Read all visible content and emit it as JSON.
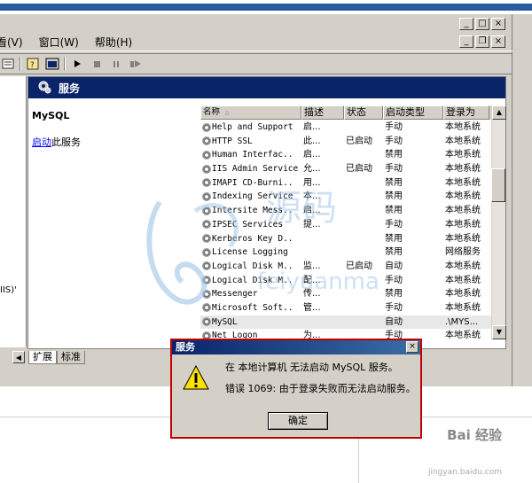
{
  "menu": {
    "view": "查看(V)",
    "window": "窗口(W)",
    "help": "帮助(H)"
  },
  "window_buttons": {
    "minimize": "_",
    "restore": "□",
    "close": "×"
  },
  "inner_window_buttons": {
    "minimize": "_",
    "restore": "❐",
    "close": "×"
  },
  "header": {
    "title": "服务"
  },
  "left_panel": {
    "truncated_text": "IIS)'"
  },
  "detail": {
    "service_name": "MySQL",
    "start_link": "启动",
    "start_suffix": "此服务"
  },
  "table": {
    "columns": [
      "名称",
      "描述",
      "状态",
      "启动类型",
      "登录为"
    ],
    "rows": [
      {
        "name": "Help and Support",
        "desc": "启...",
        "status": "",
        "startup": "手动",
        "logon": "本地系统"
      },
      {
        "name": "HTTP SSL",
        "desc": "此...",
        "status": "已启动",
        "startup": "手动",
        "logon": "本地系统"
      },
      {
        "name": "Human Interfac..",
        "desc": "启...",
        "status": "",
        "startup": "禁用",
        "logon": "本地系统"
      },
      {
        "name": "IIS Admin Service",
        "desc": "允...",
        "status": "已启动",
        "startup": "手动",
        "logon": "本地系统"
      },
      {
        "name": "IMAPI CD-Burni..",
        "desc": "用...",
        "status": "",
        "startup": "禁用",
        "logon": "本地系统"
      },
      {
        "name": "Indexing Service",
        "desc": "本...",
        "status": "",
        "startup": "禁用",
        "logon": "本地系统"
      },
      {
        "name": "Intersite Mess..",
        "desc": "启...",
        "status": "",
        "startup": "禁用",
        "logon": "本地系统"
      },
      {
        "name": "IPSEC Services",
        "desc": "提...",
        "status": "",
        "startup": "手动",
        "logon": "本地系统"
      },
      {
        "name": "Kerberos Key D..",
        "desc": "",
        "status": "",
        "startup": "禁用",
        "logon": "本地系统"
      },
      {
        "name": "License Logging",
        "desc": "",
        "status": "",
        "startup": "禁用",
        "logon": "网络服务"
      },
      {
        "name": "Logical Disk M..",
        "desc": "监...",
        "status": "已启动",
        "startup": "自动",
        "logon": "本地系统"
      },
      {
        "name": "Logical Disk M..",
        "desc": "配...",
        "status": "",
        "startup": "手动",
        "logon": "本地系统"
      },
      {
        "name": "Messenger",
        "desc": "传...",
        "status": "",
        "startup": "禁用",
        "logon": "本地系统"
      },
      {
        "name": "Microsoft Soft..",
        "desc": "管...",
        "status": "",
        "startup": "手动",
        "logon": "本地系统"
      },
      {
        "name": "MySQL",
        "desc": "",
        "status": "",
        "startup": "自动",
        "logon": ".\\MYS..."
      },
      {
        "name": "Net Logon",
        "desc": "为...",
        "status": "",
        "startup": "手动",
        "logon": "本地系统"
      }
    ]
  },
  "tabs": [
    {
      "label": "扩展"
    },
    {
      "label": "标准"
    }
  ],
  "scrollbar": {
    "up": "▲",
    "down": "▼",
    "left": "◀"
  },
  "dialog": {
    "title": "服务",
    "close": "×",
    "message1": "在 本地计算机 无法启动 MySQL 服务。",
    "message2": "错误 1069: 由于登录失败而无法启动服务。",
    "ok_label": "确定"
  },
  "watermark": {
    "text": "feiyuanma"
  },
  "baidu": {
    "logo": "Bai 经验",
    "url": "jingyan.baidu.com"
  },
  "colors": {
    "banner": "#0a246a",
    "window_bg": "#d4d0c8",
    "dialog_border": "#c00000"
  }
}
